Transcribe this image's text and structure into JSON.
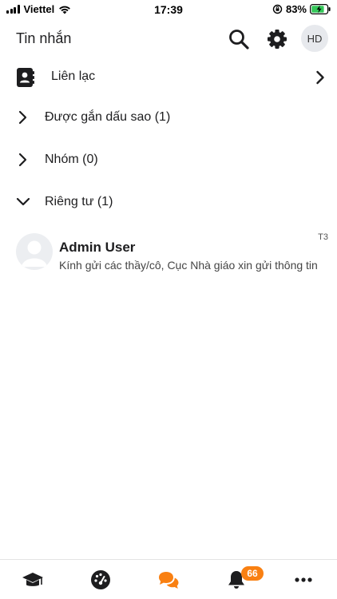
{
  "status_bar": {
    "carrier": "Viettel",
    "time": "17:39",
    "battery_percent": "83%",
    "battery_level": 0.83
  },
  "header": {
    "title": "Tin nhắn",
    "avatar_initials": "HD"
  },
  "contacts": {
    "label": "Liên lạc"
  },
  "sections": [
    {
      "label": "Được gắn dấu sao (1)",
      "expanded": false
    },
    {
      "label": "Nhóm (0)",
      "expanded": false
    },
    {
      "label": "Riêng tư (1)",
      "expanded": true
    }
  ],
  "conversation": {
    "name": "Admin User",
    "time": "T3",
    "preview": "Kính gửi các thầy/cô, Cục Nhà giáo xin gửi thông tin"
  },
  "bottom_nav": {
    "active": "messages",
    "notification_count": "66"
  },
  "colors": {
    "accent": "#f98012",
    "icon": "#1d1d1f",
    "text_muted": "#444444"
  }
}
